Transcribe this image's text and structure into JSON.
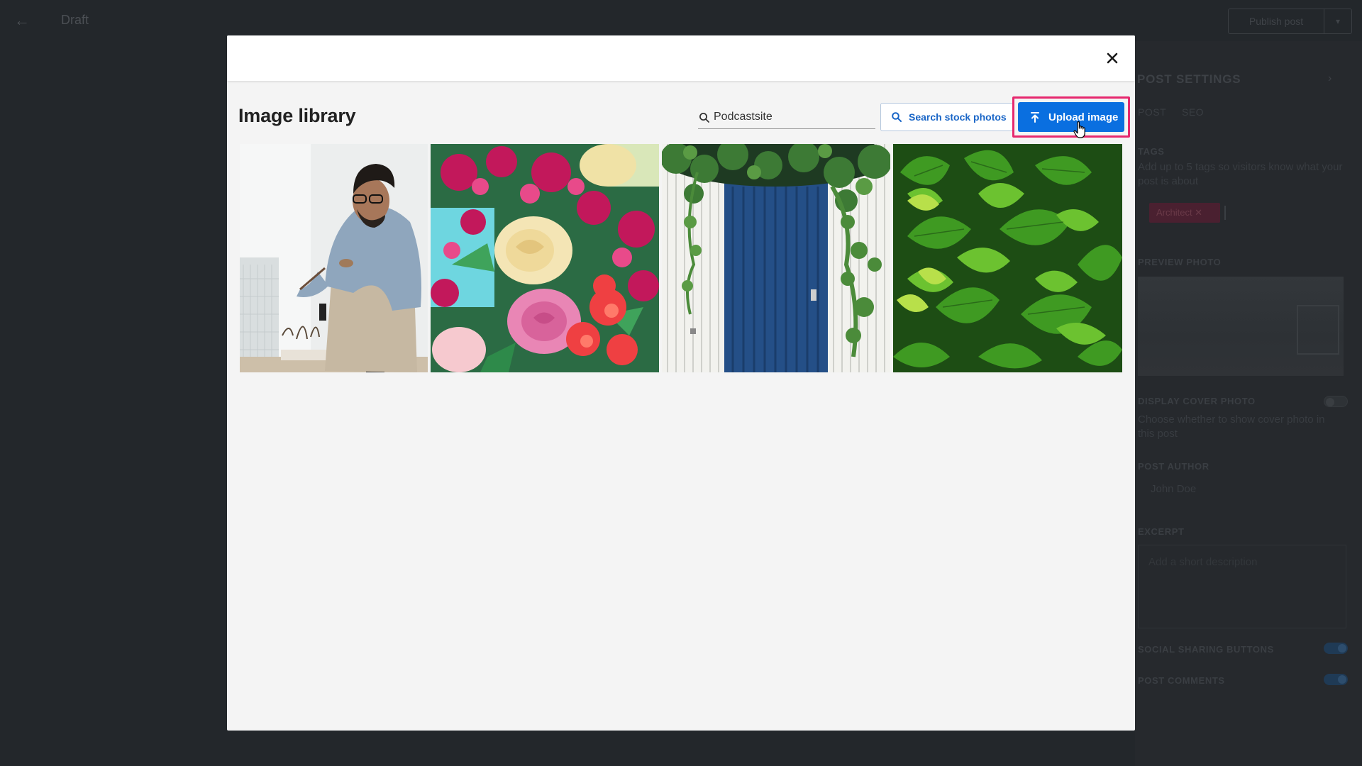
{
  "editor": {
    "status": "Draft",
    "publish_label": "Publish post",
    "settings_title": "POST SETTINGS",
    "tabs": [
      "POST",
      "SEO"
    ],
    "tags_label": "TAGS",
    "tags_help": "Add up to 5 tags so visitors know what your post is about",
    "tag_chip": "Architect ✕",
    "preview_label": "PREVIEW PHOTO",
    "display_cover_label": "DISPLAY COVER PHOTO",
    "display_cover_help": "Choose whether to show cover photo in this post",
    "author_label": "POST AUTHOR",
    "author_value": "John Doe",
    "excerpt_label": "EXCERPT",
    "excerpt_placeholder": "Add a short description",
    "social_label": "SOCIAL SHARING BUTTONS",
    "comments_label": "POST COMMENTS",
    "social_enabled": true,
    "comments_enabled": true,
    "display_cover_enabled": false
  },
  "modal": {
    "title": "Image library",
    "search": {
      "value": "Podcastsite",
      "placeholder": "Search"
    },
    "stock_button": "Search stock photos",
    "upload_button": "Upload image",
    "images": [
      {
        "subject": "architect-with-model"
      },
      {
        "subject": "flower-bouquet"
      },
      {
        "subject": "blue-door-with-ivy"
      },
      {
        "subject": "green-nettle-leaves"
      }
    ]
  },
  "colors": {
    "accent": "#0a6fe0",
    "highlight": "#e6286e",
    "modal_bg": "#f4f4f4",
    "overlay": "#23272b"
  }
}
